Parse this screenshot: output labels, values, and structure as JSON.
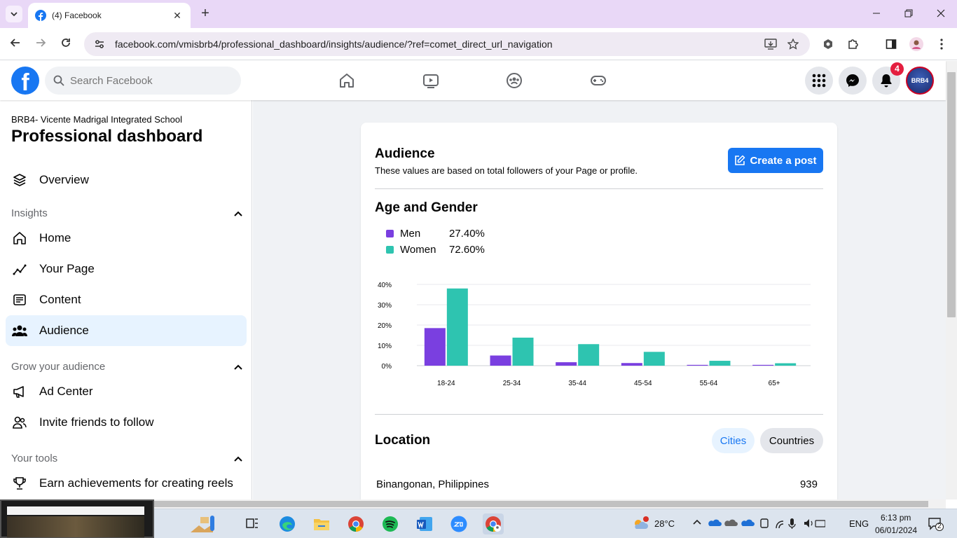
{
  "browser": {
    "tab_title": "(4) Facebook",
    "new_tab": "+",
    "close_tab": "✕",
    "url": "facebook.com/vmisbrb4/professional_dashboard/insights/audience/?ref=comet_direct_url_navigation"
  },
  "fb": {
    "logo": "f",
    "search_placeholder": "Search Facebook",
    "notification_count": "4",
    "avatar_text": "BRB4"
  },
  "sidebar": {
    "page_name": "BRB4- Vicente Madrigal Integrated School",
    "title": "Professional dashboard",
    "overview": "Overview",
    "insights_header": "Insights",
    "insights_items": [
      "Home",
      "Your Page",
      "Content",
      "Audience"
    ],
    "grow_header": "Grow your audience",
    "grow_items": [
      "Ad Center",
      "Invite friends to follow"
    ],
    "tools_header": "Your tools",
    "tools_items": [
      "Earn achievements for creating reels"
    ]
  },
  "audience": {
    "title": "Audience",
    "subtitle": "These values are based on total followers of your Page or profile.",
    "create_post": "Create a post",
    "age_gender_title": "Age and Gender",
    "legend": [
      {
        "name": "Men",
        "value": "27.40%",
        "color": "#7a3fe0"
      },
      {
        "name": "Women",
        "value": "72.60%",
        "color": "#2ec4b0"
      }
    ],
    "location_title": "Location",
    "cities_label": "Cities",
    "countries_label": "Countries",
    "location_rows": [
      {
        "place": "Binangonan, Philippines",
        "count": "939"
      }
    ]
  },
  "chart_data": {
    "type": "bar",
    "categories": [
      "18-24",
      "25-34",
      "35-44",
      "45-54",
      "55-64",
      "65+"
    ],
    "series": [
      {
        "name": "Men",
        "values": [
          18.5,
          5.0,
          1.7,
          1.3,
          0.4,
          0.4
        ],
        "color": "#7a3fe0"
      },
      {
        "name": "Women",
        "values": [
          38.0,
          13.8,
          10.6,
          6.8,
          2.4,
          1.2
        ],
        "color": "#2ec4b0"
      }
    ],
    "yticks": [
      "40%",
      "30%",
      "20%",
      "10%",
      "0%"
    ],
    "ylim": [
      0,
      40
    ],
    "grid": true
  },
  "taskbar": {
    "weather": "28°C",
    "lang": "ENG",
    "time": "6:13 pm",
    "date": "06/01/2024",
    "notif": "2"
  }
}
